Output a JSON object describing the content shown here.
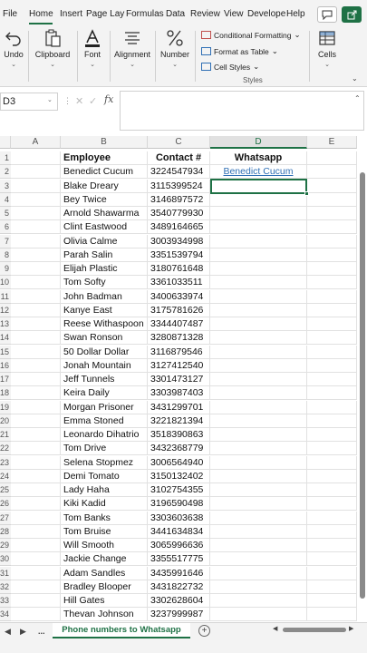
{
  "ribbon_tabs": [
    "File",
    "Home",
    "Insert",
    "Page Layout",
    "Formulas",
    "Data",
    "Review",
    "View",
    "Developer",
    "Help"
  ],
  "ribbon_tabs_visible": [
    "File",
    "Home",
    "Insert",
    "Page Lay",
    "Formulas",
    "Data",
    "Review",
    "View",
    "Develope",
    "Help"
  ],
  "active_tab": "Home",
  "accent_color": "#1e7145",
  "ribbon": {
    "undo": "Undo",
    "clipboard": "Clipboard",
    "font": "Font",
    "alignment": "Alignment",
    "number": "Number",
    "conditional_formatting": "Conditional Formatting",
    "format_as_table": "Format as Table",
    "cell_styles": "Cell Styles",
    "styles_group": "Styles",
    "cells": "Cells"
  },
  "formula_bar": {
    "name_box": "D3",
    "fx_label": "fx",
    "value": ""
  },
  "columns": [
    "A",
    "B",
    "C",
    "D",
    "E"
  ],
  "selected_column": "D",
  "row_numbers": [
    "1",
    "2",
    "3",
    "4",
    "5",
    "6",
    "7",
    "8",
    "9",
    "10",
    "11",
    "12",
    "13",
    "14",
    "15",
    "16",
    "17",
    "18",
    "19",
    "20",
    "21",
    "22",
    "23",
    "24",
    "25",
    "26",
    "27",
    "28",
    "29",
    "30",
    "31",
    "32",
    "33",
    "34"
  ],
  "headers": {
    "employee": "Employee",
    "contact": "Contact #",
    "whatsapp": "Whatsapp"
  },
  "rows": [
    {
      "name": "Benedict Cucum",
      "contact": "3224547934",
      "whatsapp": "Benedict Cucum"
    },
    {
      "name": "Blake Dreary",
      "contact": "3115399524",
      "whatsapp": ""
    },
    {
      "name": "Bey Twice",
      "contact": "3146897572",
      "whatsapp": ""
    },
    {
      "name": "Arnold Shawarma",
      "contact": "3540779930",
      "whatsapp": ""
    },
    {
      "name": "Clint Eastwood",
      "contact": "3489164665",
      "whatsapp": ""
    },
    {
      "name": "Olivia Calme",
      "contact": "3003934998",
      "whatsapp": ""
    },
    {
      "name": "Parah Salin",
      "contact": "3351539794",
      "whatsapp": ""
    },
    {
      "name": "Elijah Plastic",
      "contact": "3180761648",
      "whatsapp": ""
    },
    {
      "name": "Tom Softy",
      "contact": "3361033511",
      "whatsapp": ""
    },
    {
      "name": "John Badman",
      "contact": "3400633974",
      "whatsapp": ""
    },
    {
      "name": "Kanye East",
      "contact": "3175781626",
      "whatsapp": ""
    },
    {
      "name": "Reese Withaspoon",
      "contact": "3344407487",
      "whatsapp": ""
    },
    {
      "name": "Swan Ronson",
      "contact": "3280871328",
      "whatsapp": ""
    },
    {
      "name": "50 Dollar Dollar",
      "contact": "3116879546",
      "whatsapp": ""
    },
    {
      "name": "Jonah Mountain",
      "contact": "3127412540",
      "whatsapp": ""
    },
    {
      "name": "Jeff Tunnels",
      "contact": "3301473127",
      "whatsapp": ""
    },
    {
      "name": "Keira Daily",
      "contact": "3303987403",
      "whatsapp": ""
    },
    {
      "name": "Morgan Prisoner",
      "contact": "3431299701",
      "whatsapp": ""
    },
    {
      "name": "Emma Stoned",
      "contact": "3221821394",
      "whatsapp": ""
    },
    {
      "name": "Leonardo Dihatrio",
      "contact": "3518390863",
      "whatsapp": ""
    },
    {
      "name": "Tom Drive",
      "contact": "3432368779",
      "whatsapp": ""
    },
    {
      "name": "Selena Stopmez",
      "contact": "3006564940",
      "whatsapp": ""
    },
    {
      "name": "Demi Tomato",
      "contact": "3150132402",
      "whatsapp": ""
    },
    {
      "name": "Lady Haha",
      "contact": "3102754355",
      "whatsapp": ""
    },
    {
      "name": "Kiki Kadid",
      "contact": "3196590498",
      "whatsapp": ""
    },
    {
      "name": "Tom Banks",
      "contact": "3303603638",
      "whatsapp": ""
    },
    {
      "name": "Tom Bruise",
      "contact": "3441634834",
      "whatsapp": ""
    },
    {
      "name": "Will Smooth",
      "contact": "3065996636",
      "whatsapp": ""
    },
    {
      "name": "Jackie Change",
      "contact": "3355517775",
      "whatsapp": ""
    },
    {
      "name": "Adam Sandles",
      "contact": "3435991646",
      "whatsapp": ""
    },
    {
      "name": "Bradley Blooper",
      "contact": "3431822732",
      "whatsapp": ""
    },
    {
      "name": "Hill Gates",
      "contact": "3302628604",
      "whatsapp": ""
    },
    {
      "name": "Thevan Johnson",
      "contact": "3237999987",
      "whatsapp": ""
    }
  ],
  "sheet_bar": {
    "more": "...",
    "active_sheet": "Phone numbers to Whatsapp"
  }
}
